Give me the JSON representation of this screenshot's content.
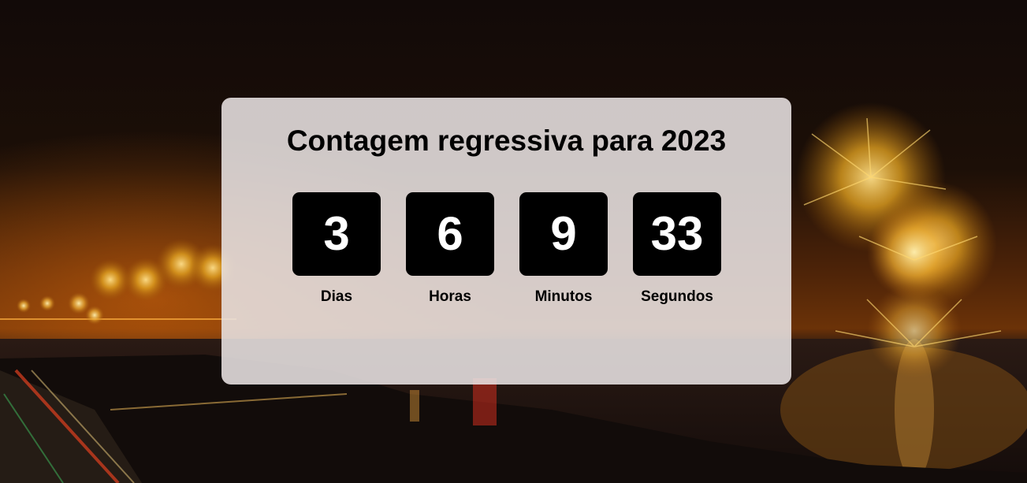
{
  "page": {
    "title": "Contagem regressiva para 2023"
  },
  "countdown": [
    {
      "value": "3",
      "label": "Dias"
    },
    {
      "value": "6",
      "label": "Horas"
    },
    {
      "value": "9",
      "label": "Minutos"
    },
    {
      "value": "33",
      "label": "Segundos"
    }
  ],
  "colors": {
    "card_background": "#e8e2e2",
    "number_box": "#000000",
    "number_text": "#ffffff",
    "label_text": "#000000"
  }
}
